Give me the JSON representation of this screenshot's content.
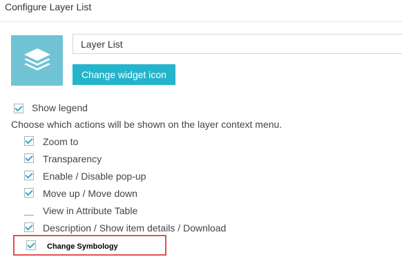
{
  "header": {
    "title": "Configure Layer List"
  },
  "widget": {
    "icon": "layers-icon",
    "name_value": "Layer List",
    "change_icon_label": "Change widget icon",
    "icon_bg_color": "#6fc3d4",
    "button_color": "#24b5cc"
  },
  "show_legend": {
    "label": "Show legend",
    "checked": true
  },
  "instructions": "Choose which actions will be shown on the layer context menu.",
  "actions": [
    {
      "label": "Zoom to",
      "checked": true
    },
    {
      "label": "Transparency",
      "checked": true
    },
    {
      "label": "Enable / Disable pop-up",
      "checked": true
    },
    {
      "label": "Move up / Move down",
      "checked": true
    },
    {
      "label": "View in Attribute Table",
      "checked": false
    },
    {
      "label": "Description / Show item details / Download",
      "checked": true
    },
    {
      "label": "Change Symbology",
      "checked": true,
      "highlighted": true
    }
  ],
  "highlight_color": "#e05050"
}
